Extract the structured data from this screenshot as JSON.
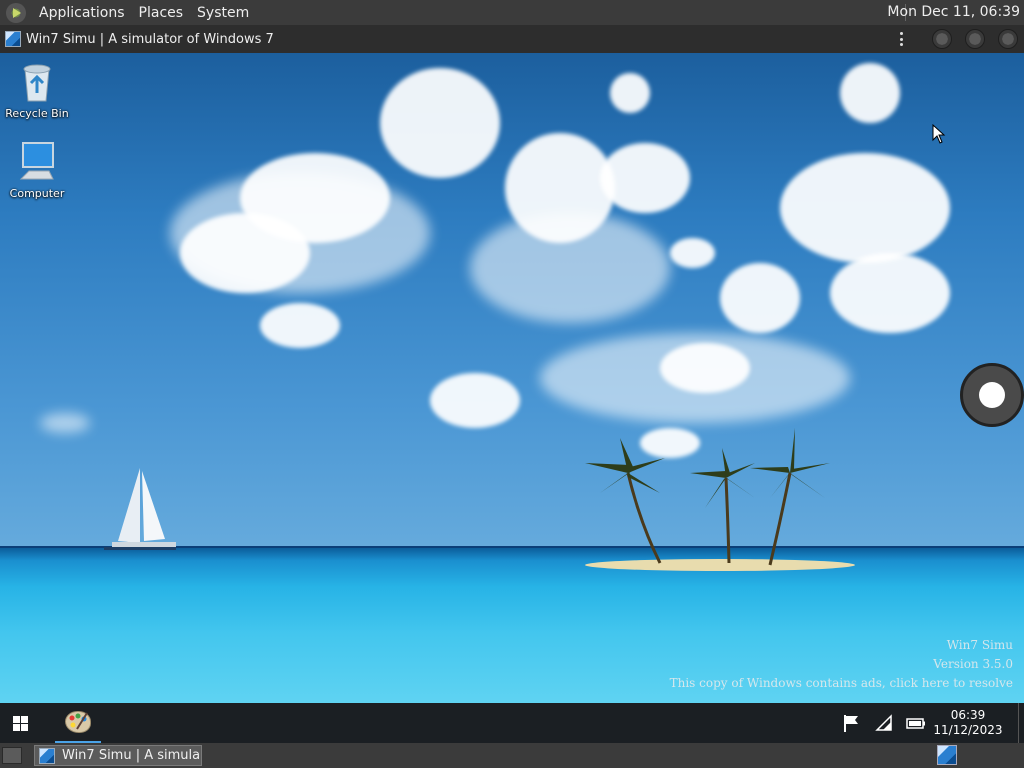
{
  "top_panel": {
    "menus": [
      "Applications",
      "Places",
      "System"
    ],
    "clock": "Mon Dec 11, 06:39"
  },
  "window": {
    "title": "Win7 Simu | A simulator of Windows 7"
  },
  "desktop": {
    "icons": [
      {
        "label": "Recycle Bin",
        "icon": "recycle-bin-icon"
      },
      {
        "label": "Computer",
        "icon": "computer-icon"
      }
    ],
    "watermark": {
      "line1": "Win7 Simu",
      "line2": "Version 3.5.0",
      "line3": "This copy of Windows contains ads, click here to resolve"
    }
  },
  "taskbar": {
    "time": "06:39",
    "date": "11/12/2023",
    "tray_icons": [
      "flag-icon",
      "wifi-icon",
      "battery-icon"
    ]
  },
  "bottom_panel": {
    "task_label": "Win7 Simu | A simula…"
  },
  "colors": {
    "panel": "#3b3b3b",
    "taskbar": "#1b1f23",
    "accent": "#4aa3e8"
  }
}
